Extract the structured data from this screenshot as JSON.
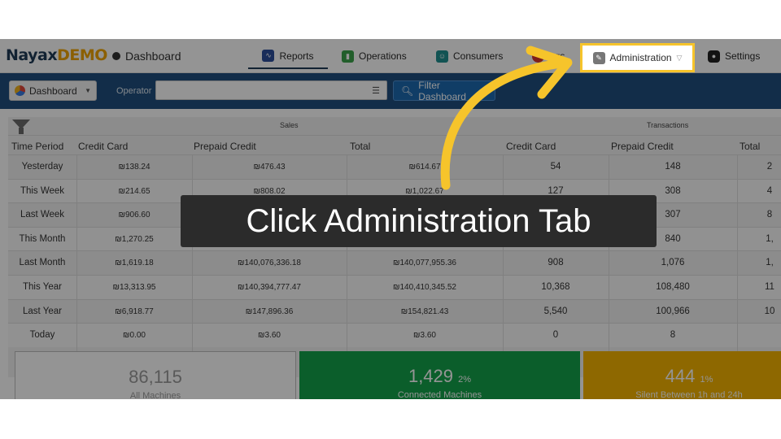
{
  "brand": {
    "name": "Nayax",
    "suffix": "DEMO"
  },
  "breadcrumb": "Dashboard",
  "nav": {
    "reports": "Reports",
    "operations": "Operations",
    "consumers": "Consumers",
    "logs": "ogs",
    "administration": "Administration",
    "settings": "Settings"
  },
  "filterbar": {
    "dashboard_label": "Dashboard",
    "operator_label": "Operator",
    "operator_value": "",
    "filter_button": "Filter Dashboard"
  },
  "table": {
    "group_sales": "Sales",
    "group_transactions": "Transactions",
    "columns": [
      "Time Period",
      "Credit Card",
      "Prepaid Credit",
      "Total",
      "Credit Card",
      "Prepaid Credit",
      "Total"
    ],
    "rows": [
      {
        "period": "Yesterday",
        "cc": "₪138.24",
        "pc": "₪476.43",
        "tot": "₪614.67",
        "tcc": "54",
        "tpc": "148",
        "ttot": "2"
      },
      {
        "period": "This Week",
        "cc": "₪214.65",
        "pc": "₪808.02",
        "tot": "₪1,022.67",
        "tcc": "127",
        "tpc": "308",
        "ttot": "4"
      },
      {
        "period": "Last Week",
        "cc": "₪906.60",
        "pc": "",
        "tot": "",
        "tcc": "",
        "tpc": "307",
        "ttot": "8"
      },
      {
        "period": "This Month",
        "cc": "₪1,270.25",
        "pc": "",
        "tot": "",
        "tcc": "",
        "tpc": "840",
        "ttot": "1,"
      },
      {
        "period": "Last Month",
        "cc": "₪1,619.18",
        "pc": "₪140,076,336.18",
        "tot": "₪140,077,955.36",
        "tcc": "908",
        "tpc": "1,076",
        "ttot": "1,"
      },
      {
        "period": "This Year",
        "cc": "₪13,313.95",
        "pc": "₪140,394,777.47",
        "tot": "₪140,410,345.52",
        "tcc": "10,368",
        "tpc": "108,480",
        "ttot": "11"
      },
      {
        "period": "Last Year",
        "cc": "₪6,918.77",
        "pc": "₪147,896.36",
        "tot": "₪154,821.43",
        "tcc": "5,540",
        "tpc": "100,966",
        "ttot": "10"
      },
      {
        "period": "Today",
        "cc": "₪0.00",
        "pc": "₪3.60",
        "tot": "₪3.60",
        "tcc": "0",
        "tpc": "8",
        "ttot": ""
      }
    ]
  },
  "cards": {
    "all": {
      "value": "86,115",
      "label": "All Machines"
    },
    "connected": {
      "value": "1,429",
      "pct": "2%",
      "label": "Connected Machines"
    },
    "silent": {
      "value": "444",
      "pct": "1%",
      "label": "Silent Between 1h and 24h"
    }
  },
  "instruction": "Click Administration Tab",
  "colors": {
    "highlight": "#f6c42b",
    "arrow": "#f6c42b",
    "header": "#1f4f7f"
  }
}
